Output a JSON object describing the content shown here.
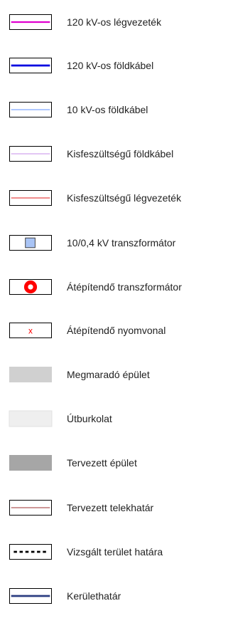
{
  "legend": {
    "items": [
      {
        "label": "120 kV-os légvezeték",
        "symbol": "line",
        "color": "#e000d0"
      },
      {
        "label": "120 kV-os földkábel",
        "symbol": "line",
        "color": "#0000e0"
      },
      {
        "label": "10 kV-os földkábel",
        "symbol": "line",
        "color": "#7fa8ff"
      },
      {
        "label": "Kisfeszültségű földkábel",
        "symbol": "line",
        "color": "#c78ee8"
      },
      {
        "label": "Kisfeszültségű légvezeték",
        "symbol": "line",
        "color": "#e21b1b"
      },
      {
        "label": "10/0,4 kV transzformátor",
        "symbol": "square",
        "color": "#a9c4f5"
      },
      {
        "label": "Átépítendő transzformátor",
        "symbol": "ring",
        "color": "#ff0000"
      },
      {
        "label": "Átépítendő nyomvonal",
        "symbol": "cross",
        "color": "#ff0000",
        "glyph": "x"
      },
      {
        "label": "Megmaradó épület",
        "symbol": "fill",
        "color": "#d0d0d0"
      },
      {
        "label": "Útburkolat",
        "symbol": "fill",
        "color": "#efefef"
      },
      {
        "label": "Tervezett épület",
        "symbol": "fill",
        "color": "#a6a6a6"
      },
      {
        "label": "Tervezett telekhatár",
        "symbol": "line",
        "color": "#9b2f2f"
      },
      {
        "label": "Vizsgált terület határa",
        "symbol": "dashed",
        "color": "#000000"
      },
      {
        "label": "Kerülethatár",
        "symbol": "line",
        "color": "#2b3d80"
      }
    ]
  }
}
